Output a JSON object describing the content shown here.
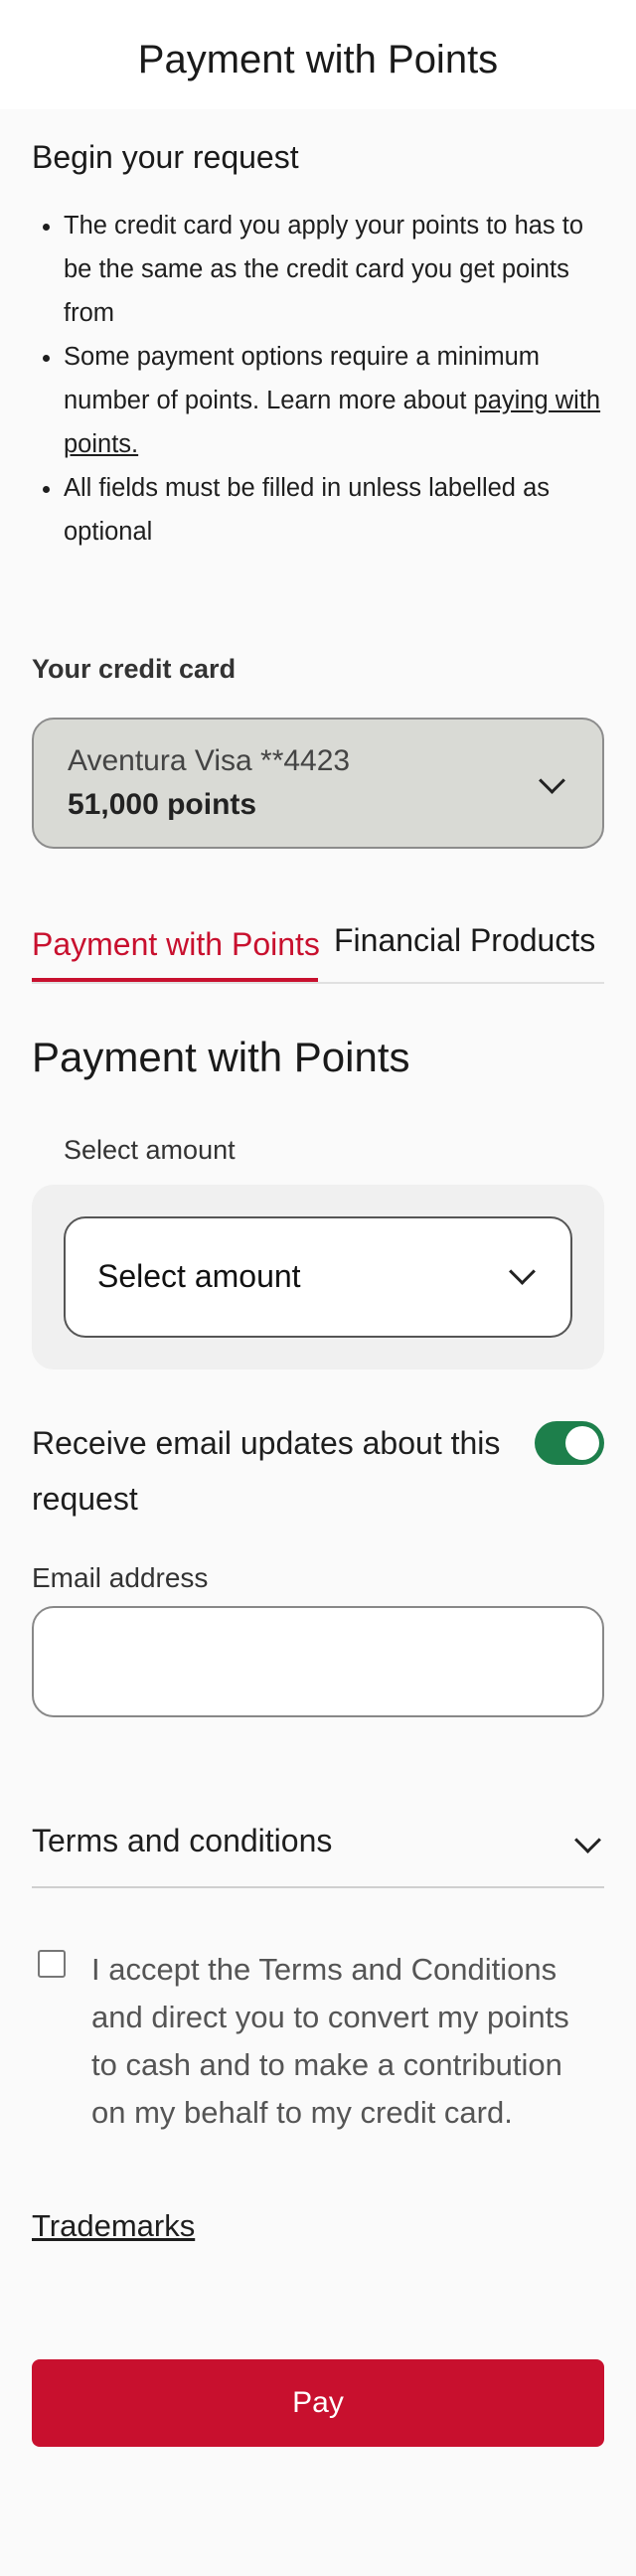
{
  "header": {
    "title": "Payment with Points"
  },
  "intro": {
    "heading": "Begin your request",
    "bullets": [
      "The credit card you apply your points to has to be the same as the credit card you get points from",
      "Some payment options require a minimum number of points. Learn more about",
      "All fields must be filled in unless labelled as optional"
    ],
    "bullet2_link": "paying with points."
  },
  "credit_card": {
    "label": "Your credit card",
    "card_name": "Aventura Visa **4423",
    "points": "51,000 points",
    "icon": "chevron-down-icon"
  },
  "tabs": [
    {
      "label": "Payment with Points",
      "active": true
    },
    {
      "label": "Financial Products",
      "active": false
    }
  ],
  "section": {
    "title": "Payment with Points"
  },
  "amount": {
    "label": "Select amount",
    "selected": "Select amount",
    "icon": "chevron-down-icon"
  },
  "email_updates": {
    "label": "Receive email updates about this request",
    "enabled": true,
    "toggle_color": "#1d7f4b"
  },
  "email": {
    "label": "Email address",
    "value": "",
    "placeholder": ""
  },
  "terms": {
    "label": "Terms and conditions",
    "icon": "chevron-down-icon"
  },
  "accept": {
    "text": "I accept the Terms and Conditions and direct you to convert my points to cash and to make a contribution on my behalf to my credit card.",
    "checked": false
  },
  "footer": {
    "trademarks": "Trademarks",
    "pay_button": "Pay"
  },
  "colors": {
    "brand_red": "#c8102e",
    "toggle_green": "#1d7f4b"
  }
}
